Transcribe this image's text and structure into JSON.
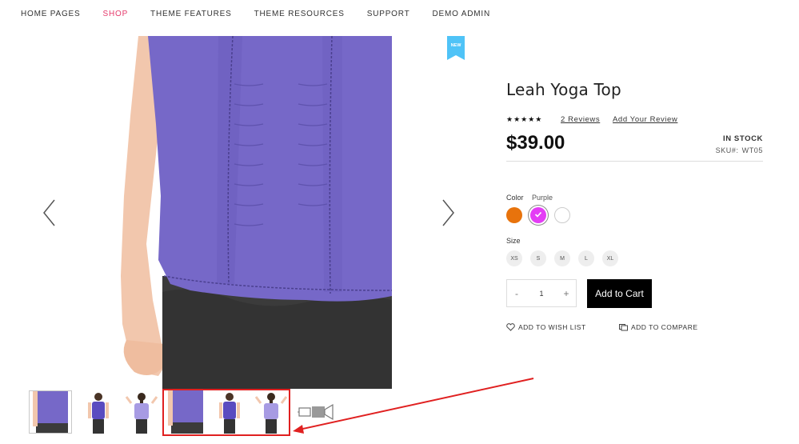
{
  "nav": {
    "items": [
      {
        "label": "HOME PAGES"
      },
      {
        "label": "SHOP"
      },
      {
        "label": "THEME FEATURES"
      },
      {
        "label": "THEME RESOURCES"
      },
      {
        "label": "SUPPORT"
      },
      {
        "label": "DEMO ADMIN"
      }
    ],
    "active_index": 1,
    "active_color": "#e5396b"
  },
  "gallery": {
    "badge": "NEW",
    "badge_color": "#4fc3f7",
    "prev_icon": "chevron-left-icon",
    "next_icon": "chevron-right-icon",
    "thumbnails": [
      {
        "name": "front-closeup",
        "selected": true
      },
      {
        "name": "front-full"
      },
      {
        "name": "back-full"
      },
      {
        "name": "front-closeup"
      },
      {
        "name": "front-full"
      },
      {
        "name": "back-full"
      },
      {
        "name": "video-icon"
      }
    ]
  },
  "product": {
    "title": "Leah Yoga Top",
    "rating_stars": "★★★★★",
    "reviews_link": "2 Reviews",
    "add_review_link": "Add Your Review",
    "price": "$39.00",
    "stock": "IN STOCK",
    "sku_label": "SKU#:",
    "sku": "WT05",
    "color_label": "Color",
    "color_selected": "Purple",
    "colors": [
      {
        "name": "Orange",
        "hex": "#e8730c"
      },
      {
        "name": "Purple",
        "hex": "#e43df5"
      },
      {
        "name": "White",
        "hex": "#ffffff"
      }
    ],
    "size_label": "Size",
    "sizes": [
      "XS",
      "S",
      "M",
      "L",
      "XL"
    ],
    "qty_minus": "-",
    "qty_value": "1",
    "qty_plus": "+",
    "add_to_cart": "Add to Cart",
    "wishlist": "ADD TO WISH LIST",
    "compare": "ADD TO COMPARE"
  }
}
